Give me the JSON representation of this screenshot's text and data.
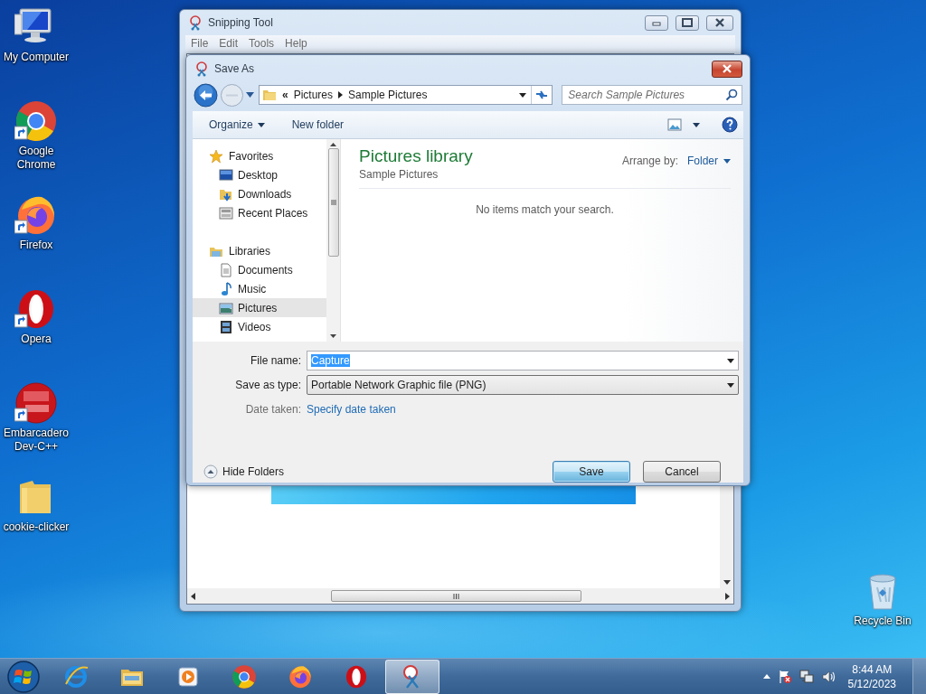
{
  "desktop_icons": [
    {
      "label": "My Computer",
      "kind": "computer",
      "shortcut": false
    },
    {
      "label": "Google Chrome",
      "kind": "chrome",
      "shortcut": true
    },
    {
      "label": "Firefox",
      "kind": "firefox",
      "shortcut": true
    },
    {
      "label": "Opera",
      "kind": "opera",
      "shortcut": true
    },
    {
      "label": "Embarcadero Dev-C++",
      "kind": "devcpp",
      "shortcut": true
    },
    {
      "label": "cookie-clicker",
      "kind": "folder",
      "shortcut": false
    },
    {
      "label": "Recycle Bin",
      "kind": "recycle",
      "shortcut": false
    }
  ],
  "snipping_tool": {
    "title": "Snipping Tool",
    "menu": [
      "File",
      "Edit",
      "Tools",
      "Help"
    ]
  },
  "save_dialog": {
    "title": "Save As",
    "address": {
      "overflow_mark": "«",
      "segments": [
        "Pictures",
        "Sample Pictures"
      ]
    },
    "search": {
      "placeholder": "Search Sample Pictures"
    },
    "toolbar": {
      "organize": "Organize",
      "new_folder": "New folder"
    },
    "navigation": [
      {
        "label": "Favorites",
        "selected": false,
        "children": [
          {
            "label": "Desktop",
            "selected": false
          },
          {
            "label": "Downloads",
            "selected": false
          },
          {
            "label": "Recent Places",
            "selected": false
          }
        ]
      },
      {
        "label": "Libraries",
        "selected": false,
        "children": [
          {
            "label": "Documents",
            "selected": false
          },
          {
            "label": "Music",
            "selected": false
          },
          {
            "label": "Pictures",
            "selected": true
          },
          {
            "label": "Videos",
            "selected": false
          }
        ]
      }
    ],
    "content": {
      "title": "Pictures library",
      "subtitle": "Sample Pictures",
      "arrange_label": "Arrange by:",
      "arrange_value": "Folder",
      "empty_message": "No items match your search."
    },
    "file_name": {
      "label": "File name:",
      "value": "Capture",
      "text_selected": true
    },
    "save_type": {
      "label": "Save as type:",
      "value": "Portable Network Graphic file (PNG)"
    },
    "date_taken": {
      "label": "Date taken:",
      "link": "Specify date taken"
    },
    "hide_folders": "Hide Folders",
    "buttons": [
      {
        "label": "Save",
        "default": true
      },
      {
        "label": "Cancel",
        "default": false
      }
    ]
  },
  "taskbar": {
    "items": [
      {
        "kind": "ie",
        "active": false
      },
      {
        "kind": "explorer",
        "active": false
      },
      {
        "kind": "media",
        "active": false
      },
      {
        "kind": "chrome",
        "active": false
      },
      {
        "kind": "firefox",
        "active": false
      },
      {
        "kind": "opera",
        "active": false
      },
      {
        "kind": "snipping",
        "active": true
      }
    ],
    "time": "8:44 AM",
    "date": "5/12/2023"
  }
}
